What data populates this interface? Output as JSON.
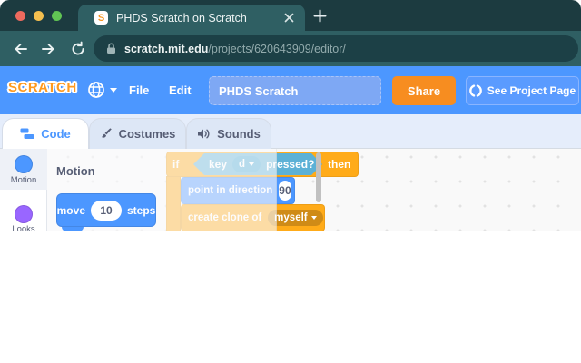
{
  "browser": {
    "tab_title": "PHDS Scratch on Scratch",
    "favicon_letter": "S",
    "url": {
      "domain": "scratch.mit.edu",
      "path": "/projects/620643909/editor/"
    }
  },
  "header": {
    "logo_text": "SCRATCH",
    "menu": {
      "file": "File",
      "edit": "Edit"
    },
    "project_name": "PHDS Scratch",
    "share_label": "Share",
    "see_project_page_label": "See Project Page"
  },
  "editor_tabs": {
    "code": "Code",
    "costumes": "Costumes",
    "sounds": "Sounds"
  },
  "categories": [
    {
      "label": "Motion",
      "color": "#4c97ff"
    },
    {
      "label": "Looks",
      "color": "#9966ff"
    }
  ],
  "palette": {
    "header": "Motion",
    "move_block": {
      "t1": "move",
      "value": "10",
      "t2": "steps"
    }
  },
  "script": {
    "if_label": "if",
    "then_label": "then",
    "key_block": {
      "t1": "key",
      "value": "d",
      "t2": "pressed?"
    },
    "point_block": {
      "t1": "point in direction",
      "value": "90"
    },
    "clone_block": {
      "t1": "create clone of",
      "value": "myself"
    }
  },
  "colors": {
    "browser_dark": "#1c3b40",
    "browser_frame": "#2f5f63",
    "scratch_blue": "#4c97ff",
    "control_orange": "#ffab19",
    "sensing_teal": "#5cb1d6",
    "looks_purple": "#9966ff",
    "share_orange": "#f78d20"
  }
}
